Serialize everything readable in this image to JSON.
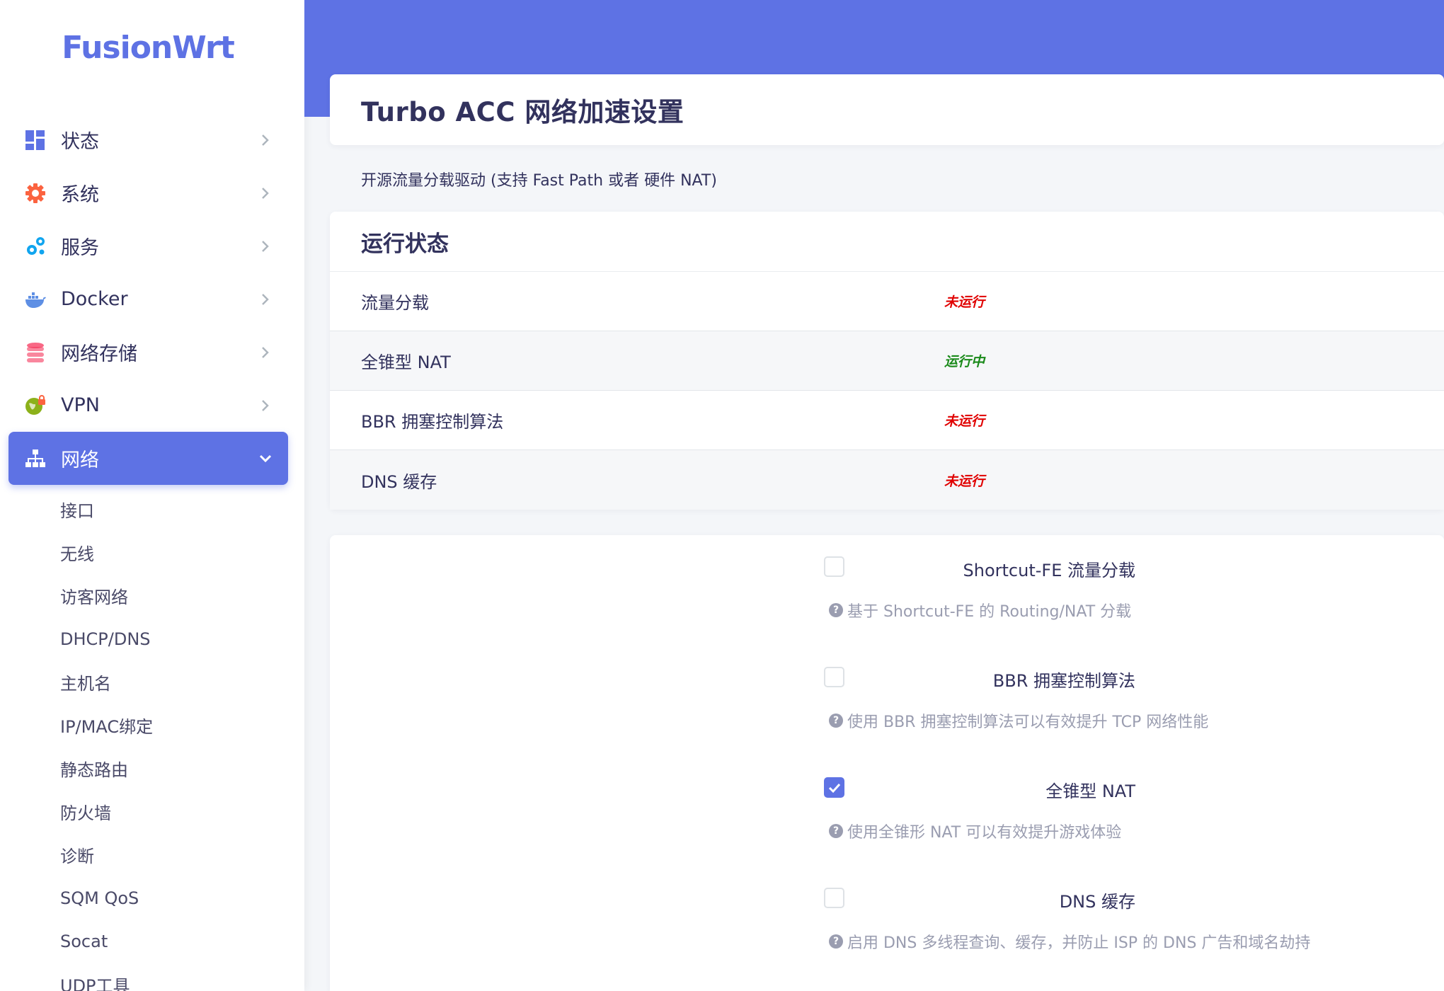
{
  "brand": {
    "logo": "FusionWrt"
  },
  "sidebar": {
    "items": [
      {
        "label": "状态",
        "icon": "dashboard-icon"
      },
      {
        "label": "系统",
        "icon": "gear-icon"
      },
      {
        "label": "服务",
        "icon": "cogs-icon"
      },
      {
        "label": "Docker",
        "icon": "docker-icon"
      },
      {
        "label": "网络存储",
        "icon": "database-icon"
      },
      {
        "label": "VPN",
        "icon": "globe-lock-icon"
      },
      {
        "label": "网络",
        "icon": "sitemap-icon"
      }
    ],
    "active": "网络",
    "submenu": [
      "接口",
      "无线",
      "访客网络",
      "DHCP/DNS",
      "主机名",
      "IP/MAC绑定",
      "静态路由",
      "防火墙",
      "诊断",
      "SQM QoS",
      "Socat",
      "UDP工具"
    ]
  },
  "page": {
    "title": "Turbo ACC 网络加速设置",
    "description": "开源流量分载驱动 (支持 Fast Path 或者 硬件 NAT)"
  },
  "status": {
    "heading": "运行状态",
    "rows": [
      {
        "name": "流量分载",
        "state": "未运行",
        "running": false
      },
      {
        "name": "全锥型 NAT",
        "state": "运行中",
        "running": true
      },
      {
        "name": "BBR 拥塞控制算法",
        "state": "未运行",
        "running": false
      },
      {
        "name": "DNS 缓存",
        "state": "未运行",
        "running": false
      }
    ]
  },
  "settings": [
    {
      "label": "Shortcut-FE 流量分载",
      "checked": false,
      "help": "基于 Shortcut-FE 的 Routing/NAT 分载"
    },
    {
      "label": "BBR 拥塞控制算法",
      "checked": false,
      "help": "使用 BBR 拥塞控制算法可以有效提升 TCP 网络性能"
    },
    {
      "label": "全锥型 NAT",
      "checked": true,
      "help": "使用全锥形 NAT 可以有效提升游戏体验"
    },
    {
      "label": "DNS 缓存",
      "checked": false,
      "help": "启用 DNS 多线程查询、缓存，并防止 ISP 的 DNS 广告和域名劫持"
    }
  ],
  "colors": {
    "accent": "#5e72e4",
    "stopped": "#e00000",
    "running": "#1a8a1a"
  }
}
